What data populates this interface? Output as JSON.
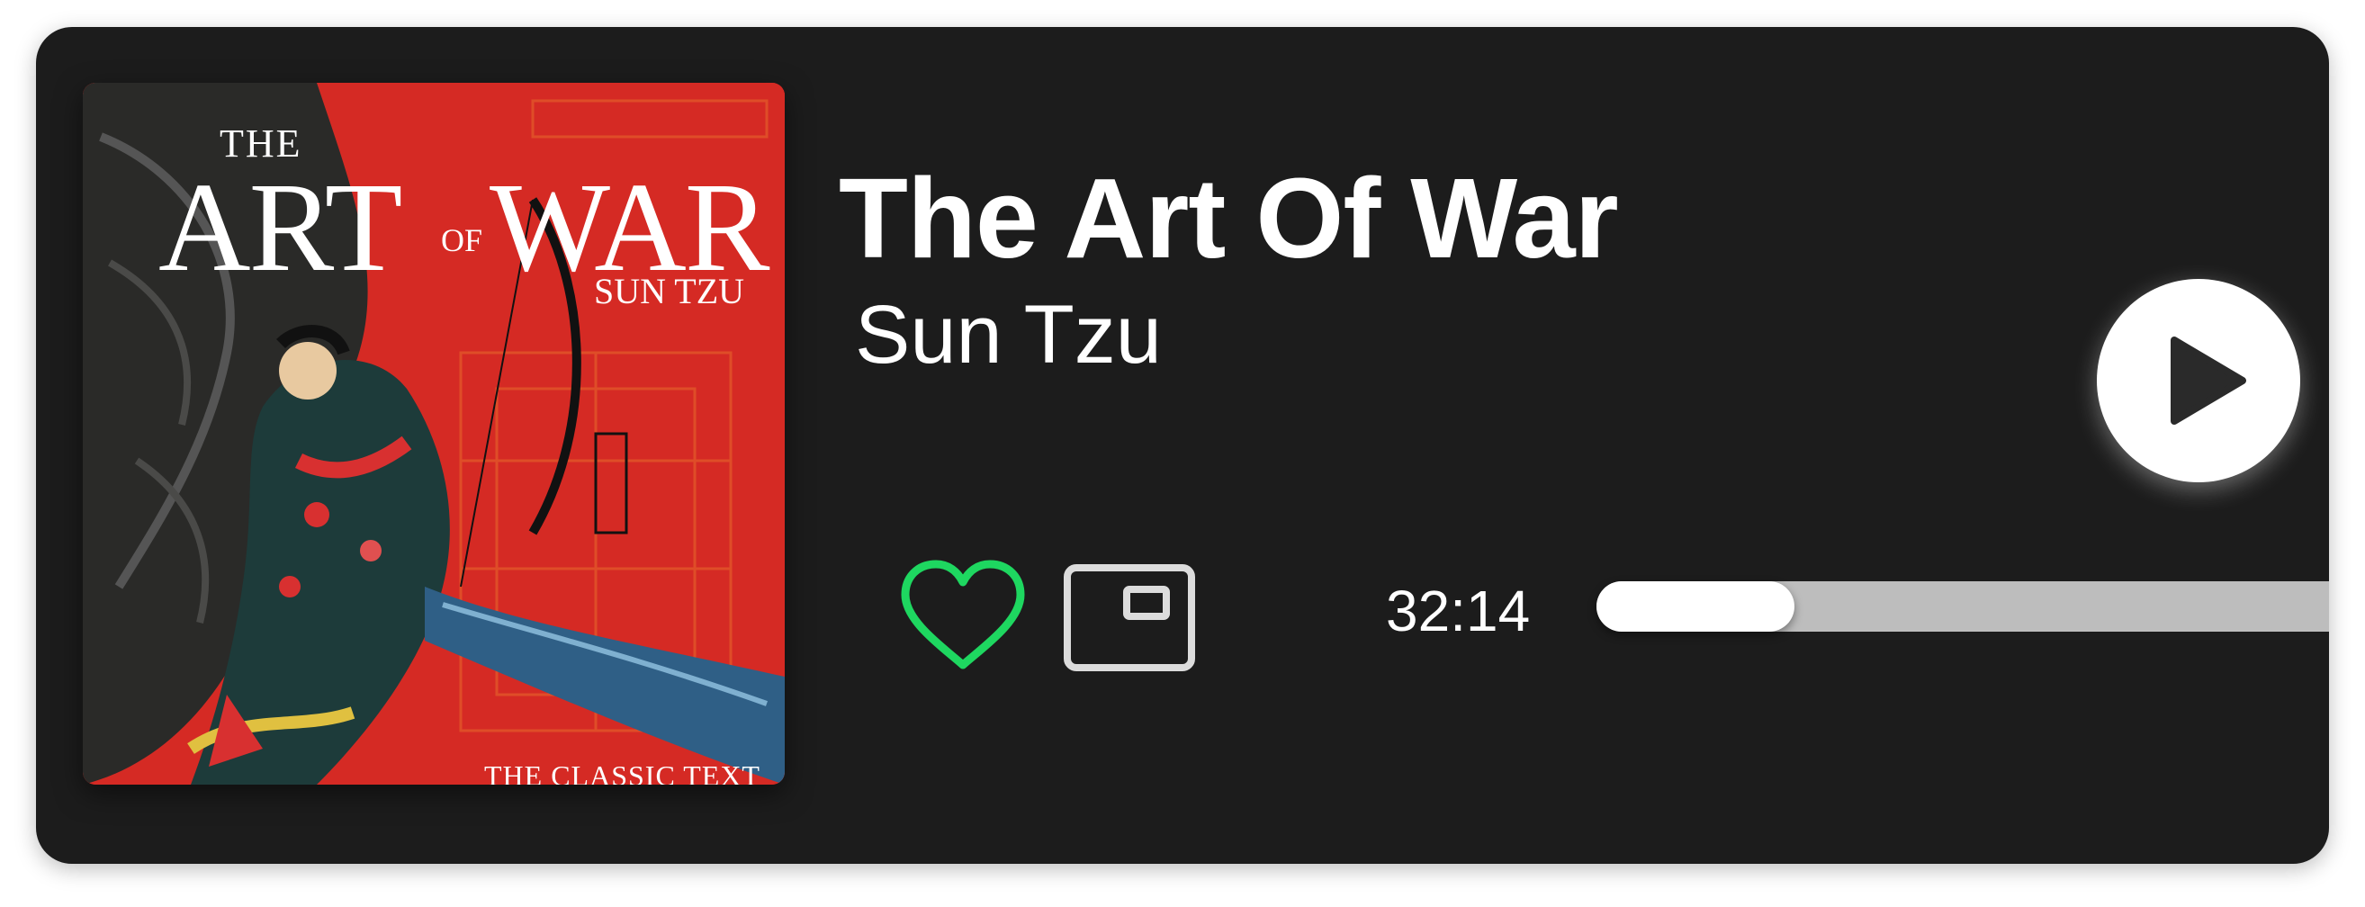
{
  "book": {
    "title": "The Art Of War",
    "author": "Sun Tzu"
  },
  "cover": {
    "line_the": "THE",
    "line_art": "ART",
    "line_of": "OF",
    "line_war": "WAR",
    "line_author": "SUN TZU",
    "line_footer": "THE CLASSIC TEXT"
  },
  "playback": {
    "elapsed": "32:14",
    "progress_fraction": 0.27,
    "liked": true
  },
  "icons": {
    "play": "play-icon",
    "like": "heart-icon",
    "miniplayer": "miniplayer-icon"
  },
  "colors": {
    "card_background": "#1c1c1c",
    "accent_green": "#1ed760",
    "cover_red": "#d52a24",
    "track_gray": "#bdbdbd"
  }
}
